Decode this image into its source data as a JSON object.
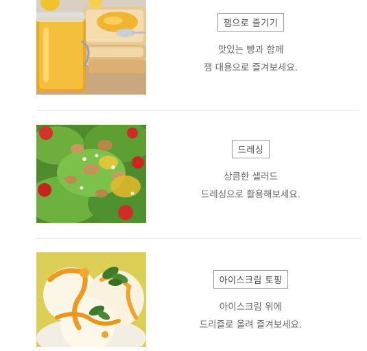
{
  "items": [
    {
      "tag": "잼으로 즐기기",
      "line1": "맛있는 빵과 함께",
      "line2": "잼 대용으로 즐겨보세요."
    },
    {
      "tag": "드레싱",
      "line1": "상큼한 샐러드",
      "line2": "드레싱으로 활용해보세요."
    },
    {
      "tag": "아이스크림 토핑",
      "line1": "아이스크림 위에",
      "line2": "드리즐로 올려 즐겨보세요."
    }
  ],
  "colors": {
    "tag_border": "#9a9a9a",
    "text": "#666666",
    "divider": "#e6e6e6"
  }
}
